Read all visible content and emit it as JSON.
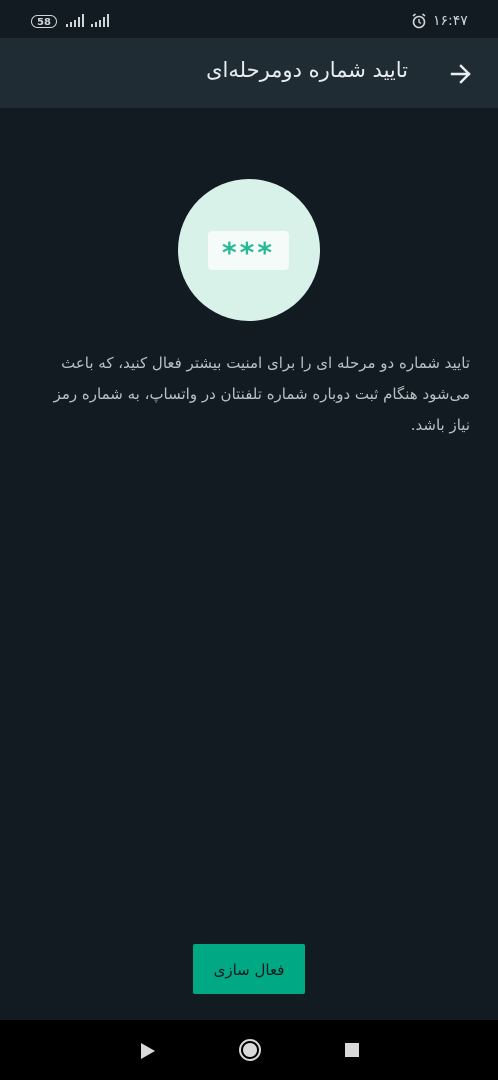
{
  "status_bar": {
    "battery_level": "58",
    "time": "۱۶:۴۷",
    "icons": [
      "battery-icon",
      "signal-icon",
      "signal-icon",
      "alarm-icon"
    ]
  },
  "app_bar": {
    "title": "تایید شماره دومرحله‌ای",
    "back_icon": "arrow-right-icon"
  },
  "illustration": {
    "pin_mask": "***",
    "circle_color": "#d8f2ea",
    "accent_color": "#29b896"
  },
  "main": {
    "description": "تایید شماره دو مرحله ای را برای امنیت بیشتر فعال کنید، که باعث می‌شود هنگام ثبت دوباره شماره تلفنتان در واتساپ، به شماره رمز نیاز باشد."
  },
  "actions": {
    "activate_label": "فعال سازی",
    "button_color": "#00a884"
  },
  "navigation_bar": {
    "icons": [
      "back-triangle-icon",
      "home-circle-icon",
      "recent-apps-square-icon"
    ]
  },
  "colors": {
    "background": "#121b22",
    "app_bar": "#202c33"
  }
}
